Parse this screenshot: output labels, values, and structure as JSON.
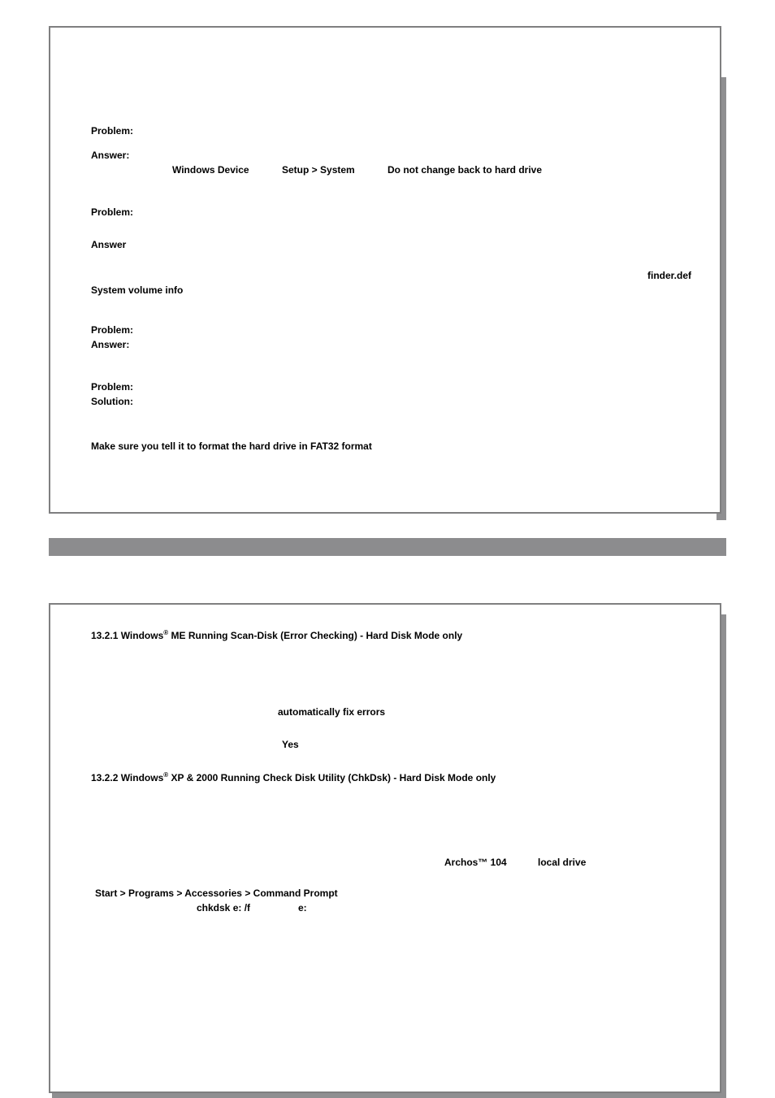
{
  "box1": {
    "q1": {
      "problem_label": "Problem:",
      "answer_label": "Answer:",
      "bold1": "Windows Device",
      "bold2": "Setup > System",
      "bold3": "Do not change back to hard drive"
    },
    "q2": {
      "problem_label": "Problem:",
      "answer_label": "Answer",
      "bold1": "finder.def",
      "bold2": "System volume info"
    },
    "q3": {
      "problem_label": "Problem:",
      "answer_label": "Answer:"
    },
    "q4": {
      "problem_label": "Problem:",
      "answer_label": "Solution:",
      "bold1": "Make sure you tell it to format the hard drive in FAT32 format"
    }
  },
  "box2": {
    "h1_prefix": "13.2.1  Windows",
    "h1_sup": "®",
    "h1_rest": " ME Running Scan-Disk (Error Checking) - Hard Disk Mode only",
    "bold_autofix": "automatically fix errors",
    "bold_yes": "Yes",
    "h2_prefix": "13.2.2  Windows",
    "h2_sup": "®",
    "h2_rest": " XP & 2000 Running Check Disk Utility (ChkDsk) - Hard Disk Mode only",
    "archos": "Archos™ 104",
    "local_drive": "local drive",
    "start_path": "Start > Programs > Accessories > Command Prompt",
    "chkdsk": "chkdsk e: /f",
    "e_colon": "e:"
  }
}
